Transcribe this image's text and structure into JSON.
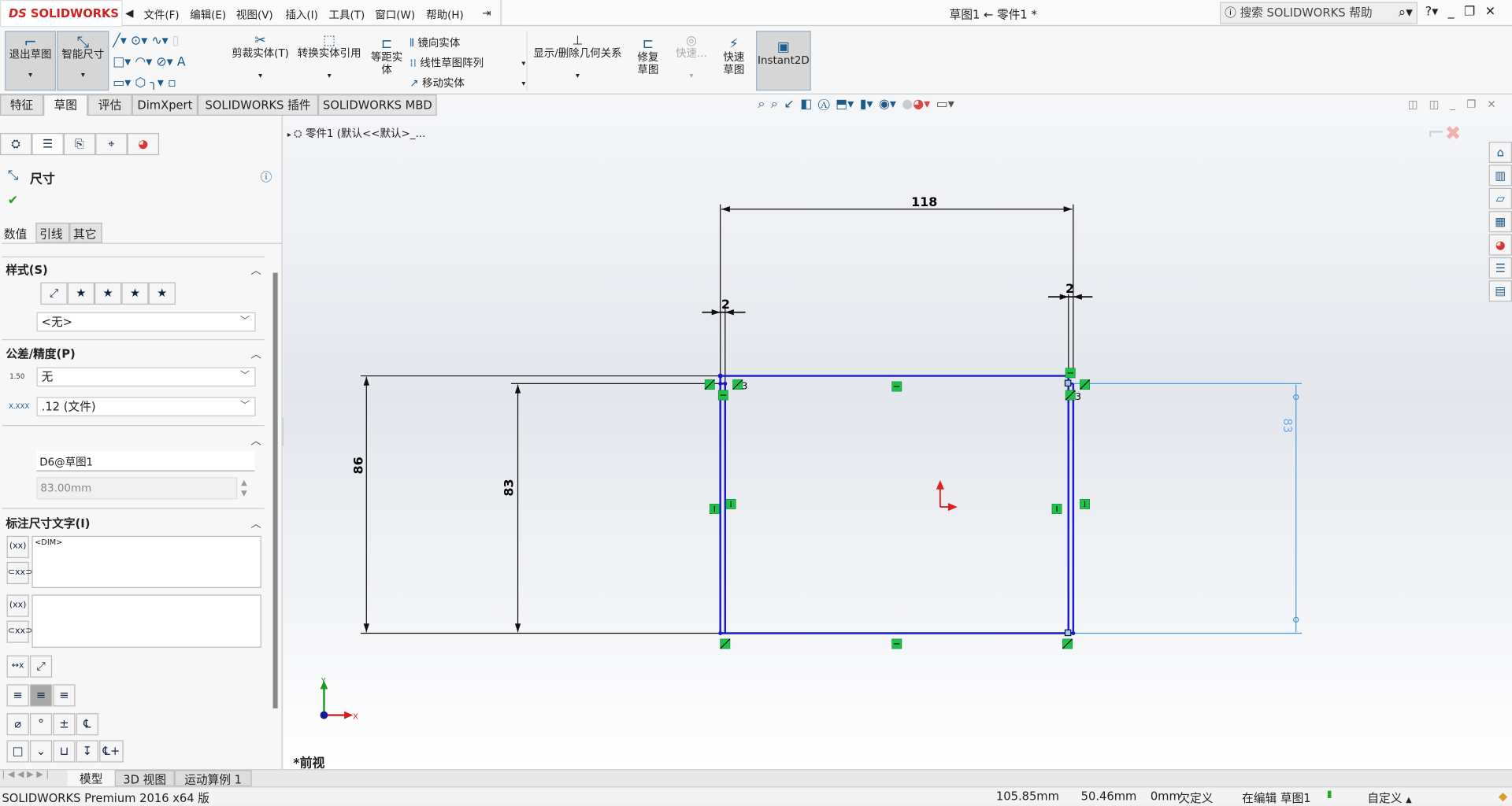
{
  "app": {
    "logo": "SOLIDWORKS",
    "title": "草图1 ← 零件1 *",
    "search_placeholder": "搜索 SOLIDWORKS 帮助"
  },
  "menu": [
    "文件(F)",
    "编辑(E)",
    "视图(V)",
    "插入(I)",
    "工具(T)",
    "窗口(W)",
    "帮助(H)"
  ],
  "toolbar": {
    "exit_sketch": "退出草图",
    "smart_dim": "智能尺寸",
    "trim": "剪裁实体(T)",
    "convert": "转换实体引用",
    "offset": "等距实体",
    "mirror": "镜向实体",
    "linear_pattern": "线性草图阵列",
    "move": "移动实体",
    "relations": "显示/删除几何关系",
    "repair": "修复草图",
    "quick_snaps": "快速...",
    "rapid_sketch": "快速草图",
    "instant2d": "Instant2D"
  },
  "tabs": [
    "特征",
    "草图",
    "评估",
    "DimXpert",
    "SOLIDWORKS 插件",
    "SOLIDWORKS MBD"
  ],
  "panel": {
    "title": "尺寸",
    "subtabs": [
      "数值",
      "引线",
      "其它"
    ],
    "style_section": "样式(S)",
    "style_value": "<无>",
    "tol_section": "公差/精度(P)",
    "tol_value": "无",
    "precision_value": ".12 (文件)",
    "tol_icon_text": "1.50",
    "prec_icon_text": "X.XXX",
    "dim_name": "D6@草图1",
    "dim_value": "83.00mm",
    "dimtext_section": "标注尺寸文字(I)",
    "dimtext_value": "<DIM>"
  },
  "tree": {
    "item": "零件1 (默认<<默认>_..."
  },
  "drawing": {
    "dims": {
      "width": "118",
      "left_wall": "2",
      "right_wall": "2",
      "outer_height": "86",
      "inner_height": "83",
      "preview": "83"
    },
    "relation_count": "3",
    "view_name": "*前视",
    "sketch_color": "#1a1acc",
    "preview_color": "#4a9be0",
    "relation_color": "#1ec24a"
  },
  "bottom_tabs": [
    "模型",
    "3D 视图",
    "运动算例 1"
  ],
  "status": {
    "product": "SOLIDWORKS Premium 2016 x64 版",
    "x": "105.85mm",
    "y": "50.46mm",
    "z": "0mm",
    "state": "欠定义",
    "editing": "在编辑 草图1",
    "units": "自定义"
  }
}
